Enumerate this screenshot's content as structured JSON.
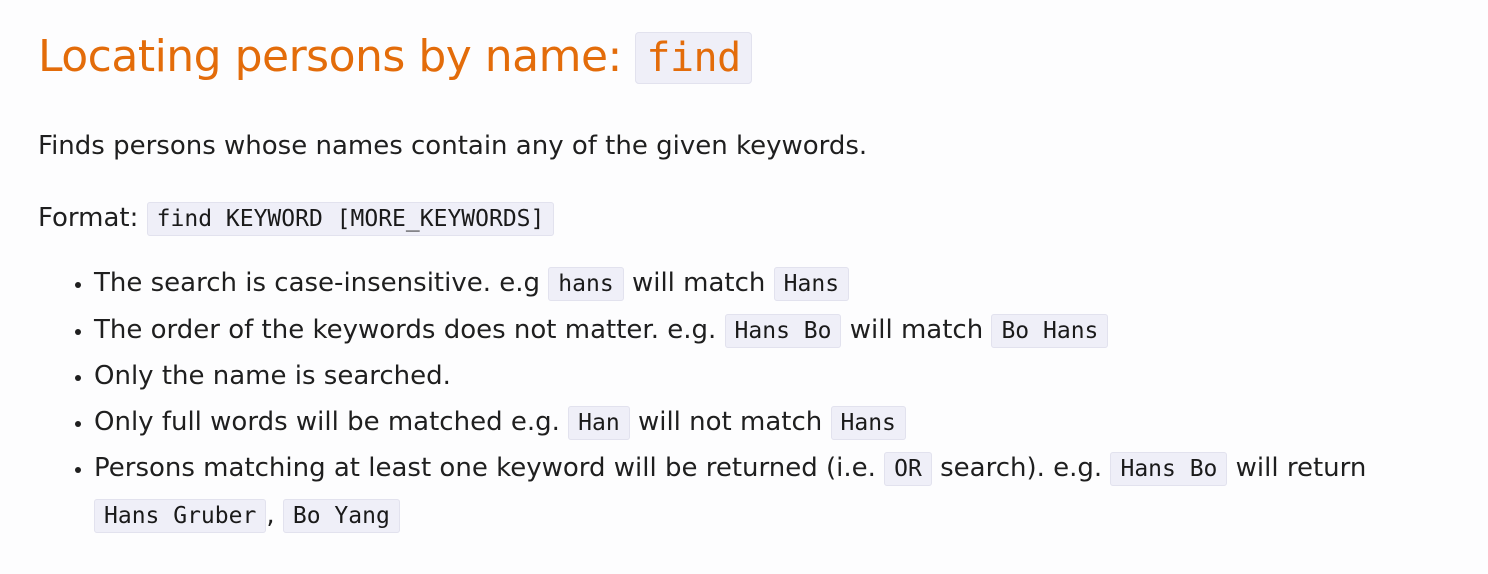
{
  "heading": {
    "text": "Locating persons by name: ",
    "command": "find"
  },
  "description": "Finds persons whose names contain any of the given keywords.",
  "format": {
    "label": "Format: ",
    "syntax": "find KEYWORD [MORE_KEYWORDS]"
  },
  "rules": [
    {
      "t1": "The search is case-insensitive. e.g ",
      "c1": "hans",
      "t2": " will match ",
      "c2": "Hans"
    },
    {
      "t1": "The order of the keywords does not matter. e.g. ",
      "c1": "Hans Bo",
      "t2": " will match ",
      "c2": "Bo Hans"
    },
    {
      "t1": "Only the name is searched."
    },
    {
      "t1": "Only full words will be matched e.g. ",
      "c1": "Han",
      "t2": " will not match ",
      "c2": "Hans"
    },
    {
      "t1": "Persons matching at least one keyword will be returned (i.e. ",
      "c1": "OR",
      "t2": " search). e.g. ",
      "c2": "Hans Bo",
      "t3": " will return ",
      "c3": "Hans Gruber",
      "t4": ", ",
      "c4": "Bo Yang"
    }
  ],
  "colors": {
    "heading": "#e36c0a",
    "code_background": "#efeff8",
    "text": "#1f1f1f"
  }
}
